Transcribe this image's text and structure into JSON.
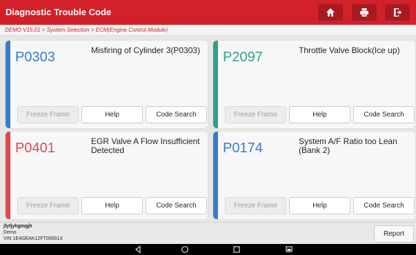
{
  "header": {
    "title": "Diagnostic Trouble Code",
    "icons": [
      "home-icon",
      "print-icon",
      "exit-icon"
    ]
  },
  "breadcrumb": "DEMO V15.01 > System Selection > ECM(Engine Control Module)",
  "colors": {
    "accent": "#d3212a",
    "blue": "#3a7cc7",
    "green": "#2aa387",
    "red": "#e0474c"
  },
  "codes": [
    {
      "code": "P0303",
      "description": "Misfiring of Cylinder 3(P0303)",
      "color": "#3a7cc7",
      "buttons": {
        "freeze": "Freeze Frame",
        "help": "Help",
        "search": "Code Search"
      }
    },
    {
      "code": "P2097",
      "description": "Throttle Valve Block(Ice up)",
      "color": "#2aa387",
      "buttons": {
        "freeze": "Freeze Frame",
        "help": "Help",
        "search": "Code Search"
      }
    },
    {
      "code": "P0401",
      "description": "EGR Valve A Flow Insufficient Detected",
      "color": "#e0474c",
      "buttons": {
        "freeze": "Freeze Frame",
        "help": "Help",
        "search": "Code Search"
      }
    },
    {
      "code": "P0174",
      "description": "System A/F Ratio too Lean (Bank 2)",
      "color": "#3a7cc7",
      "buttons": {
        "freeze": "Freeze Frame",
        "help": "Help",
        "search": "Code Search"
      }
    }
  ],
  "vehicle": {
    "name": "jfyfjyhgmgjh",
    "mode": "Demo",
    "vin": "VIN 1E4GEAK12FT00001X"
  },
  "report_label": "Report",
  "nav_icons": [
    "back-icon",
    "home-circle-icon",
    "recents-icon",
    "screenshot-icon"
  ]
}
